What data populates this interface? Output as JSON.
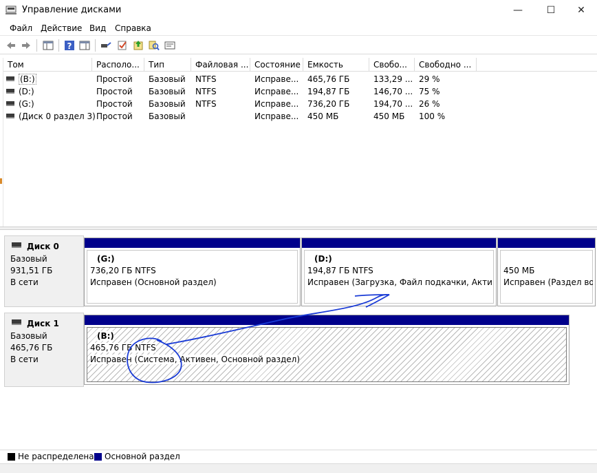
{
  "window": {
    "title": "Управление дисками",
    "controls": {
      "minimize": "—",
      "maximize": "☐",
      "close": "✕"
    }
  },
  "menu": [
    "Файл",
    "Действие",
    "Вид",
    "Справка"
  ],
  "volume_table": {
    "columns": [
      "Том",
      "Располо...",
      "Тип",
      "Файловая ...",
      "Состояние",
      "Емкость",
      "Свобо...",
      "Свободно ..."
    ],
    "rows": [
      [
        "(B:)",
        "Простой",
        "Базовый",
        "NTFS",
        "Исправе...",
        "465,76 ГБ",
        "133,29 ...",
        "29 %"
      ],
      [
        "(D:)",
        "Простой",
        "Базовый",
        "NTFS",
        "Исправе...",
        "194,87 ГБ",
        "146,70 ...",
        "75 %"
      ],
      [
        "(G:)",
        "Простой",
        "Базовый",
        "NTFS",
        "Исправе...",
        "736,20 ГБ",
        "194,70 ...",
        "26 %"
      ],
      [
        "(Диск 0 раздел 3)",
        "Простой",
        "Базовый",
        "",
        "Исправе...",
        "450 МБ",
        "450 МБ",
        "100 %"
      ]
    ]
  },
  "disks": [
    {
      "name": "Диск 0",
      "type": "Базовый",
      "size": "931,51 ГБ",
      "status": "В сети",
      "partitions": [
        {
          "name": "(G:)",
          "size": "736,20 ГБ NTFS",
          "status": "Исправен (Основной раздел)"
        },
        {
          "name": "(D:)",
          "size": "194,87 ГБ NTFS",
          "status": "Исправен (Загрузка, Файл подкачки, Активен"
        },
        {
          "name": "",
          "size": "450 МБ",
          "status": "Исправен (Раздел во"
        }
      ]
    },
    {
      "name": "Диск 1",
      "type": "Базовый",
      "size": "465,76 ГБ",
      "status": "В сети",
      "partitions": [
        {
          "name": "(B:)",
          "size": "465,76 ГБ NTFS",
          "status": "Исправен (Система, Активен, Основной раздел)"
        }
      ]
    }
  ],
  "legend": [
    {
      "label": "Не распределена",
      "color": "#000000"
    },
    {
      "label": "Основной раздел",
      "color": "#00008b"
    }
  ],
  "colors": {
    "primary_partition": "#00008b",
    "unallocated": "#000000",
    "annotation_ink": "#1a3bd6"
  }
}
